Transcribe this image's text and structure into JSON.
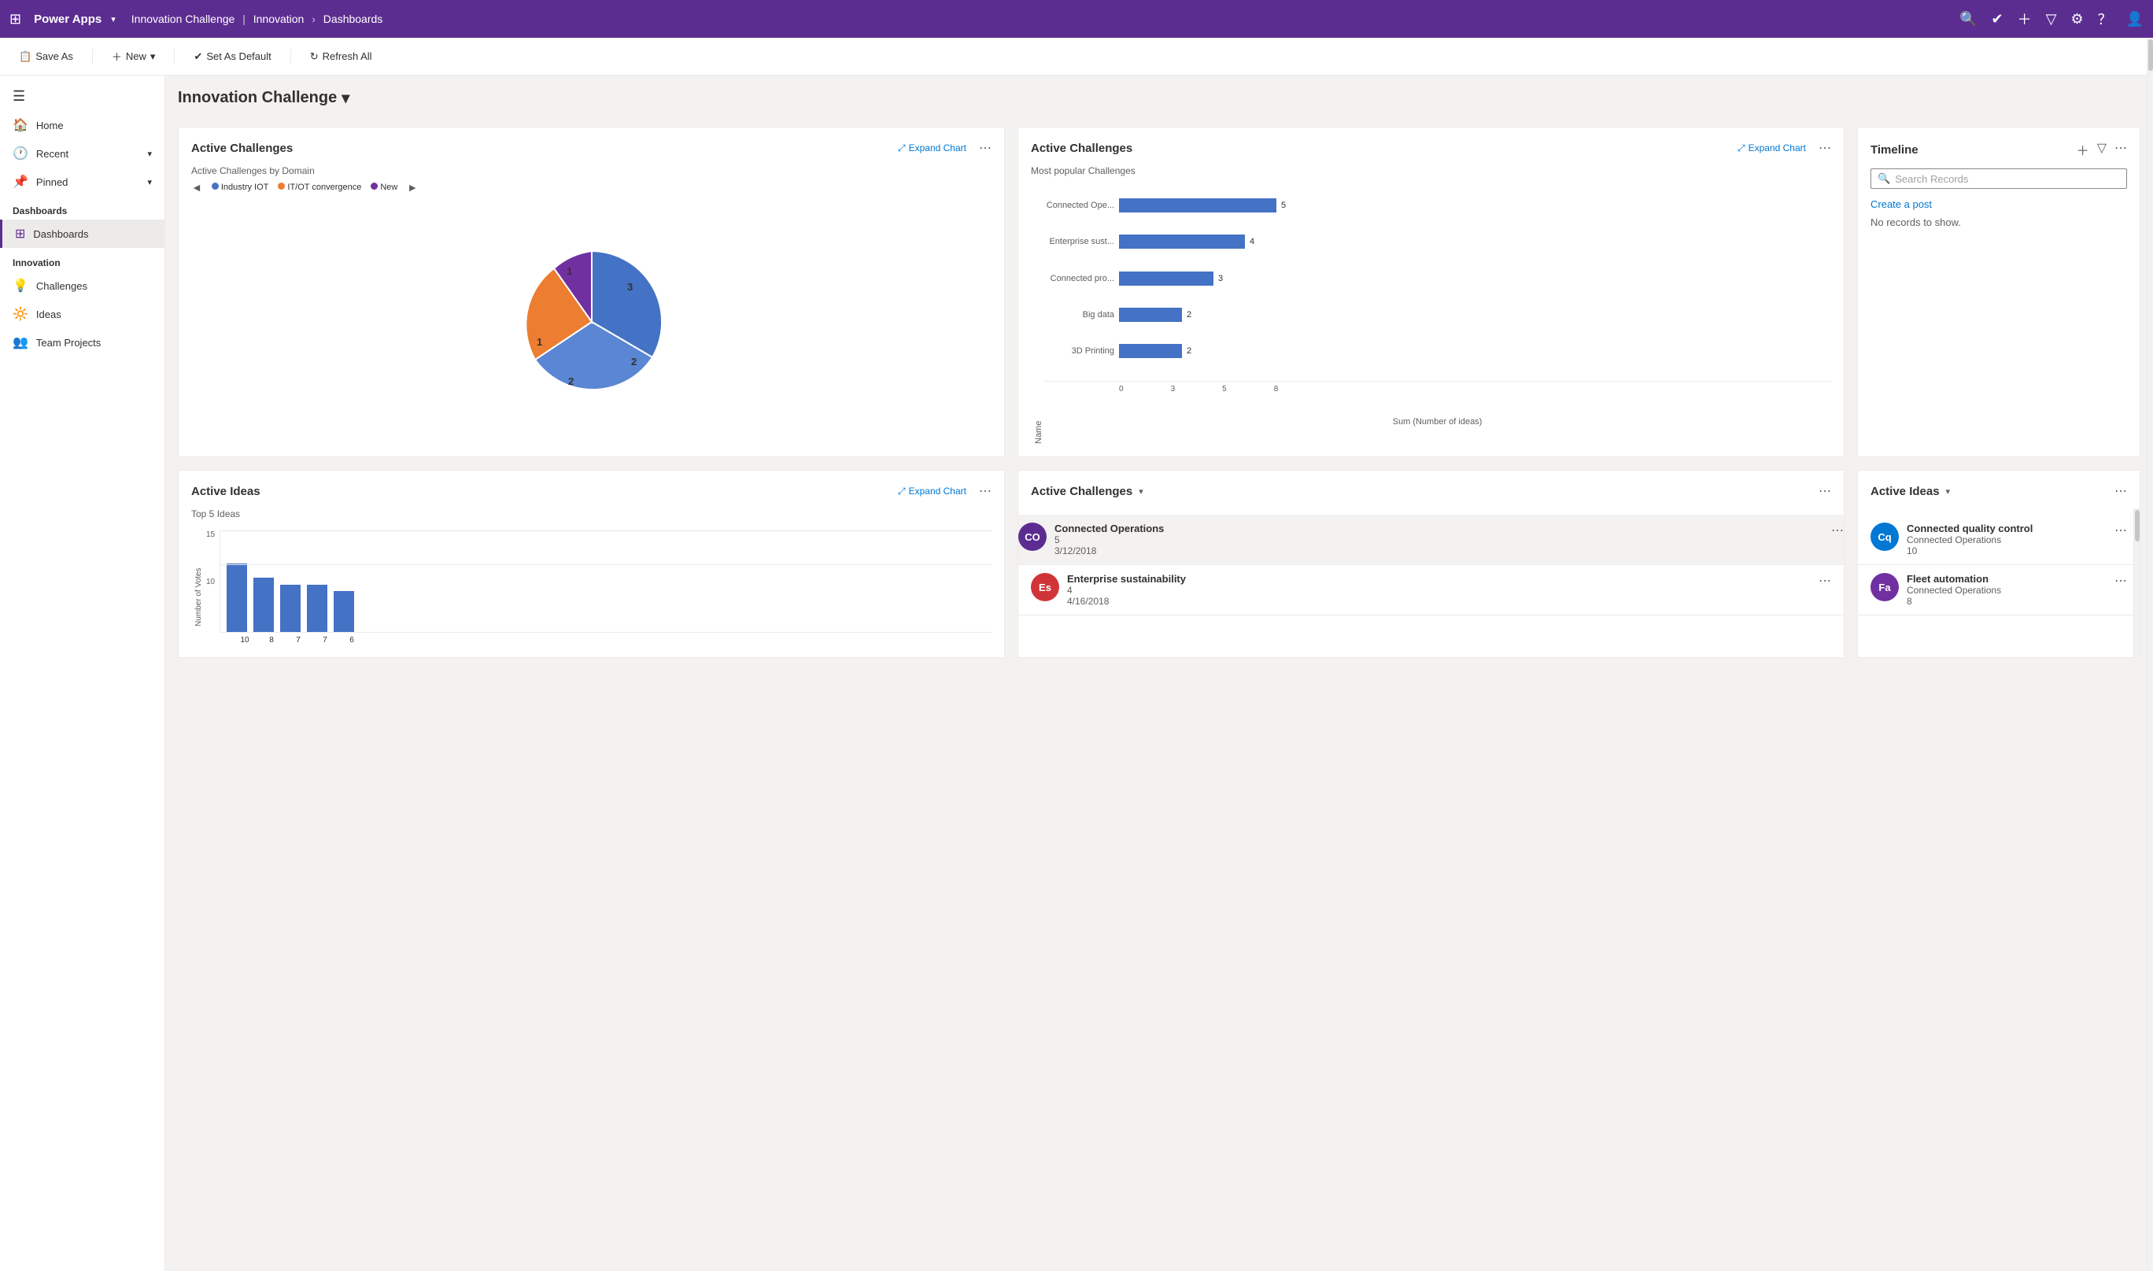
{
  "topNav": {
    "waffle": "⬛",
    "appName": "Power Apps",
    "chevron": "▾",
    "breadcrumb1": "Innovation Challenge",
    "breadcrumb2": "Innovation",
    "breadcrumb3": "Dashboards",
    "icons": [
      "🔍",
      "☑",
      "＋",
      "▽",
      "⚙",
      "？",
      "👤"
    ]
  },
  "toolbar": {
    "saveAs": "Save As",
    "new": "New",
    "setAsDefault": "Set As Default",
    "refreshAll": "Refresh All"
  },
  "sidebar": {
    "hamburger": "☰",
    "home": "Home",
    "recent": "Recent",
    "pinned": "Pinned",
    "sectionDashboards": "Dashboards",
    "dashboards": "Dashboards",
    "sectionInnovation": "Innovation",
    "challenges": "Challenges",
    "ideas": "Ideas",
    "teamProjects": "Team Projects"
  },
  "pageTitle": "Innovation Challenge",
  "card1": {
    "title": "Active Challenges",
    "expandChart": "Expand Chart",
    "subtitle": "Active Challenges by Domain",
    "legend": [
      "Industry IOT",
      "IT/OT convergence",
      "New"
    ],
    "legendColors": [
      "#4472c4",
      "#ed7d31",
      "#7030a0"
    ],
    "pieData": [
      {
        "label": "2",
        "value": 2,
        "color": "#4472c4",
        "startAngle": 0,
        "endAngle": 80
      },
      {
        "label": "3",
        "value": 3,
        "color": "#4472c4",
        "startAngle": 80,
        "endAngle": 200
      },
      {
        "label": "1",
        "value": 1,
        "color": "#ed7d31",
        "startAngle": 200,
        "endAngle": 245
      },
      {
        "label": "2",
        "value": 2,
        "color": "#ed7d31",
        "startAngle": 245,
        "endAngle": 320
      },
      {
        "label": "1",
        "value": 1,
        "color": "#7030a0",
        "startAngle": 320,
        "endAngle": 360
      }
    ]
  },
  "card2": {
    "title": "Active Challenges",
    "expandChart": "Expand Chart",
    "subtitle": "Most popular Challenges",
    "yAxisLabel": "Name",
    "xAxisLabel": "Sum (Number of ideas)",
    "bars": [
      {
        "label": "Connected Ope...",
        "value": 5,
        "max": 8
      },
      {
        "label": "Enterprise sust...",
        "value": 4,
        "max": 8
      },
      {
        "label": "Connected pro...",
        "value": 3,
        "max": 8
      },
      {
        "label": "Big data",
        "value": 2,
        "max": 8
      },
      {
        "label": "3D Printing",
        "value": 2,
        "max": 8
      }
    ],
    "xTicks": [
      "0",
      "3",
      "5",
      "8"
    ]
  },
  "card3": {
    "title": "Timeline",
    "searchPlaceholder": "Search Records",
    "createPost": "Create a post",
    "noRecords": "No records to show."
  },
  "card4": {
    "title": "Active Ideas",
    "expandChart": "Expand Chart",
    "subtitle": "Top 5 Ideas",
    "yAxisLabel": "Number of Votes",
    "bars": [
      {
        "label": "",
        "value": 10
      },
      {
        "label": "",
        "value": 8
      },
      {
        "label": "",
        "value": 7
      },
      {
        "label": "",
        "value": 7
      },
      {
        "label": "",
        "value": 6
      }
    ],
    "yTicks": [
      "15",
      "10",
      ""
    ]
  },
  "card5": {
    "title": "Active Challenges",
    "items": [
      {
        "initials": "CO",
        "color": "#5c2d91",
        "title": "Connected Operations",
        "sub1": "5",
        "sub2": "3/12/2018",
        "highlighted": true
      },
      {
        "initials": "Es",
        "color": "#d13438",
        "title": "Enterprise sustainability",
        "sub1": "4",
        "sub2": "4/16/2018",
        "highlighted": false
      }
    ]
  },
  "card6": {
    "title": "Active Ideas",
    "items": [
      {
        "initials": "Cq",
        "color": "#0078d4",
        "title": "Connected quality control",
        "sub1": "Connected Operations",
        "sub2": "10"
      },
      {
        "initials": "Fa",
        "color": "#7030a0",
        "title": "Fleet automation",
        "sub1": "Connected Operations",
        "sub2": "8"
      }
    ]
  }
}
